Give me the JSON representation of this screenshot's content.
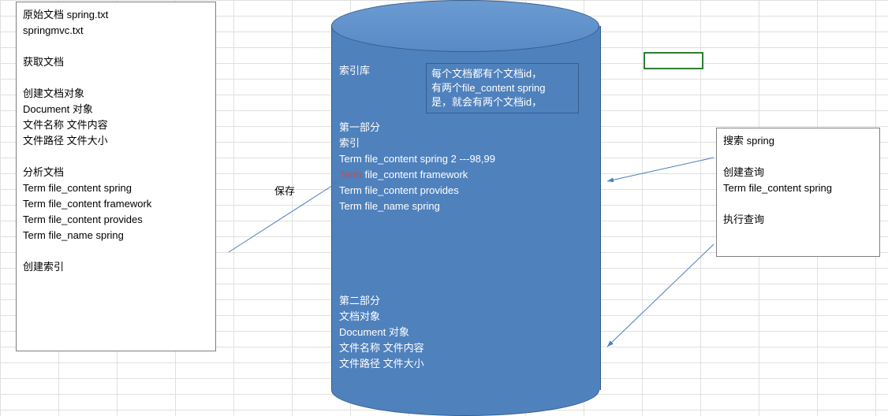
{
  "leftBox": {
    "line1": "原始文档 spring.txt",
    "line2": "springmvc.txt",
    "sec2_l1": "获取文档",
    "sec3_l1": "创建文档对象",
    "sec3_l2": "Document 对象",
    "sec3_l3": "文件名称 文件内容",
    "sec3_l4": "文件路径 文件大小",
    "sec4_l1": "分析文档",
    "sec4_l2": "Term  file_content spring",
    "sec4_l3": "Term  file_content framework",
    "sec4_l4": "Term  file_content provides",
    "sec4_l5": "Term  file_name spring",
    "sec5_l1": "创建索引"
  },
  "saveLabel": "保存",
  "cylinder": {
    "title": "索引库",
    "callout_l1": "每个文档都有个文档id，",
    "callout_l2": "有两个file_content spring",
    "callout_l3": "是，就会有两个文档id，",
    "p1_l1": "第一部分",
    "p1_l2": "索引",
    "p1_l3": "Term  file_content spring    2  ---98,99",
    "p1_l4a": "Term",
    "p1_l4b": "  file_content framework",
    "p1_l5": "Term  file_content provides",
    "p1_l6": "Term  file_name spring",
    "p2_l1": "第二部分",
    "p2_l2": "文档对象",
    "p2_l3": "Document 对象",
    "p2_l4": "文件名称 文件内容",
    "p2_l5": "文件路径 文件大小"
  },
  "rightBox": {
    "l1": "搜索    spring",
    "l2": "创建查询",
    "l3": "Term  file_content spring",
    "l4": "执行查询"
  }
}
